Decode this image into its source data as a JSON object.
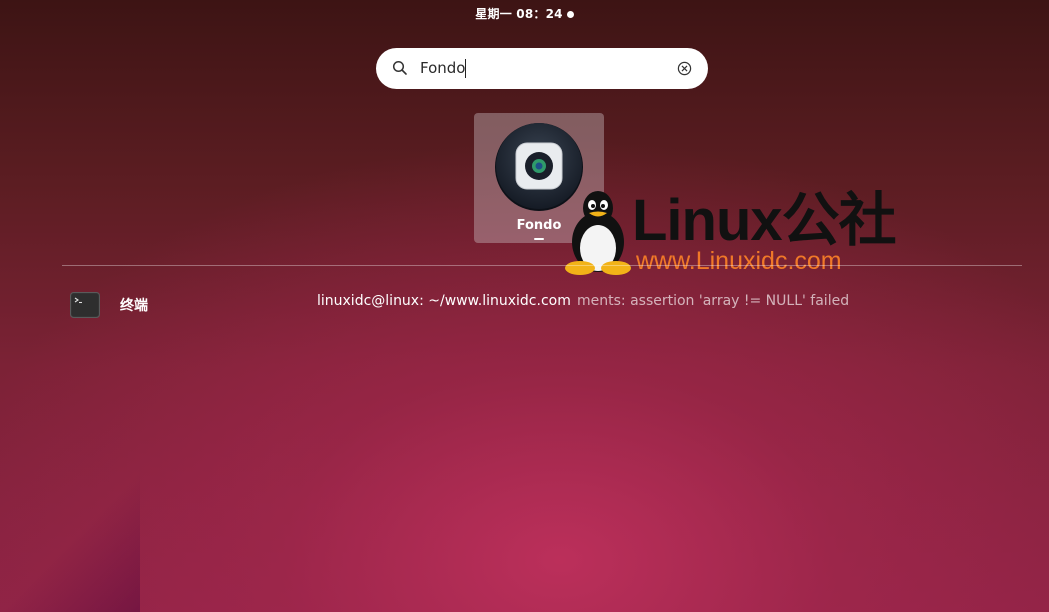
{
  "topbar": {
    "clock": "星期一 08：24"
  },
  "search": {
    "value": "Fondo",
    "icon": "search-icon",
    "clear_icon": "clear-icon"
  },
  "apps": [
    {
      "label": "Fondo",
      "icon": "fondo-app-icon"
    }
  ],
  "watermark": {
    "title": "Linux公社",
    "url": "www.Linuxidc.com"
  },
  "provider": {
    "name": "终端",
    "icon": "terminal-icon",
    "result_title": "linuxidc@linux: ~/www.linuxidc.com",
    "result_description": "ments: assertion 'array != NULL' failed"
  },
  "colors": {
    "accent_orange": "#f07828",
    "search_bg": "#ffffff"
  }
}
